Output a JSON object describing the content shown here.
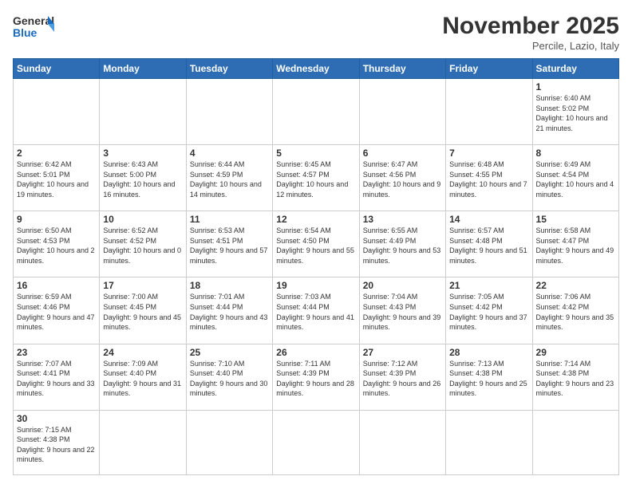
{
  "header": {
    "logo_general": "General",
    "logo_blue": "Blue",
    "month_title": "November 2025",
    "location": "Percile, Lazio, Italy"
  },
  "weekdays": [
    "Sunday",
    "Monday",
    "Tuesday",
    "Wednesday",
    "Thursday",
    "Friday",
    "Saturday"
  ],
  "weeks": [
    [
      {
        "day": "",
        "info": ""
      },
      {
        "day": "",
        "info": ""
      },
      {
        "day": "",
        "info": ""
      },
      {
        "day": "",
        "info": ""
      },
      {
        "day": "",
        "info": ""
      },
      {
        "day": "",
        "info": ""
      },
      {
        "day": "1",
        "info": "Sunrise: 6:40 AM\nSunset: 5:02 PM\nDaylight: 10 hours\nand 21 minutes."
      }
    ],
    [
      {
        "day": "2",
        "info": "Sunrise: 6:42 AM\nSunset: 5:01 PM\nDaylight: 10 hours\nand 19 minutes."
      },
      {
        "day": "3",
        "info": "Sunrise: 6:43 AM\nSunset: 5:00 PM\nDaylight: 10 hours\nand 16 minutes."
      },
      {
        "day": "4",
        "info": "Sunrise: 6:44 AM\nSunset: 4:59 PM\nDaylight: 10 hours\nand 14 minutes."
      },
      {
        "day": "5",
        "info": "Sunrise: 6:45 AM\nSunset: 4:57 PM\nDaylight: 10 hours\nand 12 minutes."
      },
      {
        "day": "6",
        "info": "Sunrise: 6:47 AM\nSunset: 4:56 PM\nDaylight: 10 hours\nand 9 minutes."
      },
      {
        "day": "7",
        "info": "Sunrise: 6:48 AM\nSunset: 4:55 PM\nDaylight: 10 hours\nand 7 minutes."
      },
      {
        "day": "8",
        "info": "Sunrise: 6:49 AM\nSunset: 4:54 PM\nDaylight: 10 hours\nand 4 minutes."
      }
    ],
    [
      {
        "day": "9",
        "info": "Sunrise: 6:50 AM\nSunset: 4:53 PM\nDaylight: 10 hours\nand 2 minutes."
      },
      {
        "day": "10",
        "info": "Sunrise: 6:52 AM\nSunset: 4:52 PM\nDaylight: 10 hours\nand 0 minutes."
      },
      {
        "day": "11",
        "info": "Sunrise: 6:53 AM\nSunset: 4:51 PM\nDaylight: 9 hours\nand 57 minutes."
      },
      {
        "day": "12",
        "info": "Sunrise: 6:54 AM\nSunset: 4:50 PM\nDaylight: 9 hours\nand 55 minutes."
      },
      {
        "day": "13",
        "info": "Sunrise: 6:55 AM\nSunset: 4:49 PM\nDaylight: 9 hours\nand 53 minutes."
      },
      {
        "day": "14",
        "info": "Sunrise: 6:57 AM\nSunset: 4:48 PM\nDaylight: 9 hours\nand 51 minutes."
      },
      {
        "day": "15",
        "info": "Sunrise: 6:58 AM\nSunset: 4:47 PM\nDaylight: 9 hours\nand 49 minutes."
      }
    ],
    [
      {
        "day": "16",
        "info": "Sunrise: 6:59 AM\nSunset: 4:46 PM\nDaylight: 9 hours\nand 47 minutes."
      },
      {
        "day": "17",
        "info": "Sunrise: 7:00 AM\nSunset: 4:45 PM\nDaylight: 9 hours\nand 45 minutes."
      },
      {
        "day": "18",
        "info": "Sunrise: 7:01 AM\nSunset: 4:44 PM\nDaylight: 9 hours\nand 43 minutes."
      },
      {
        "day": "19",
        "info": "Sunrise: 7:03 AM\nSunset: 4:44 PM\nDaylight: 9 hours\nand 41 minutes."
      },
      {
        "day": "20",
        "info": "Sunrise: 7:04 AM\nSunset: 4:43 PM\nDaylight: 9 hours\nand 39 minutes."
      },
      {
        "day": "21",
        "info": "Sunrise: 7:05 AM\nSunset: 4:42 PM\nDaylight: 9 hours\nand 37 minutes."
      },
      {
        "day": "22",
        "info": "Sunrise: 7:06 AM\nSunset: 4:42 PM\nDaylight: 9 hours\nand 35 minutes."
      }
    ],
    [
      {
        "day": "23",
        "info": "Sunrise: 7:07 AM\nSunset: 4:41 PM\nDaylight: 9 hours\nand 33 minutes."
      },
      {
        "day": "24",
        "info": "Sunrise: 7:09 AM\nSunset: 4:40 PM\nDaylight: 9 hours\nand 31 minutes."
      },
      {
        "day": "25",
        "info": "Sunrise: 7:10 AM\nSunset: 4:40 PM\nDaylight: 9 hours\nand 30 minutes."
      },
      {
        "day": "26",
        "info": "Sunrise: 7:11 AM\nSunset: 4:39 PM\nDaylight: 9 hours\nand 28 minutes."
      },
      {
        "day": "27",
        "info": "Sunrise: 7:12 AM\nSunset: 4:39 PM\nDaylight: 9 hours\nand 26 minutes."
      },
      {
        "day": "28",
        "info": "Sunrise: 7:13 AM\nSunset: 4:38 PM\nDaylight: 9 hours\nand 25 minutes."
      },
      {
        "day": "29",
        "info": "Sunrise: 7:14 AM\nSunset: 4:38 PM\nDaylight: 9 hours\nand 23 minutes."
      }
    ],
    [
      {
        "day": "30",
        "info": "Sunrise: 7:15 AM\nSunset: 4:38 PM\nDaylight: 9 hours\nand 22 minutes."
      },
      {
        "day": "",
        "info": ""
      },
      {
        "day": "",
        "info": ""
      },
      {
        "day": "",
        "info": ""
      },
      {
        "day": "",
        "info": ""
      },
      {
        "day": "",
        "info": ""
      },
      {
        "day": "",
        "info": ""
      }
    ]
  ]
}
